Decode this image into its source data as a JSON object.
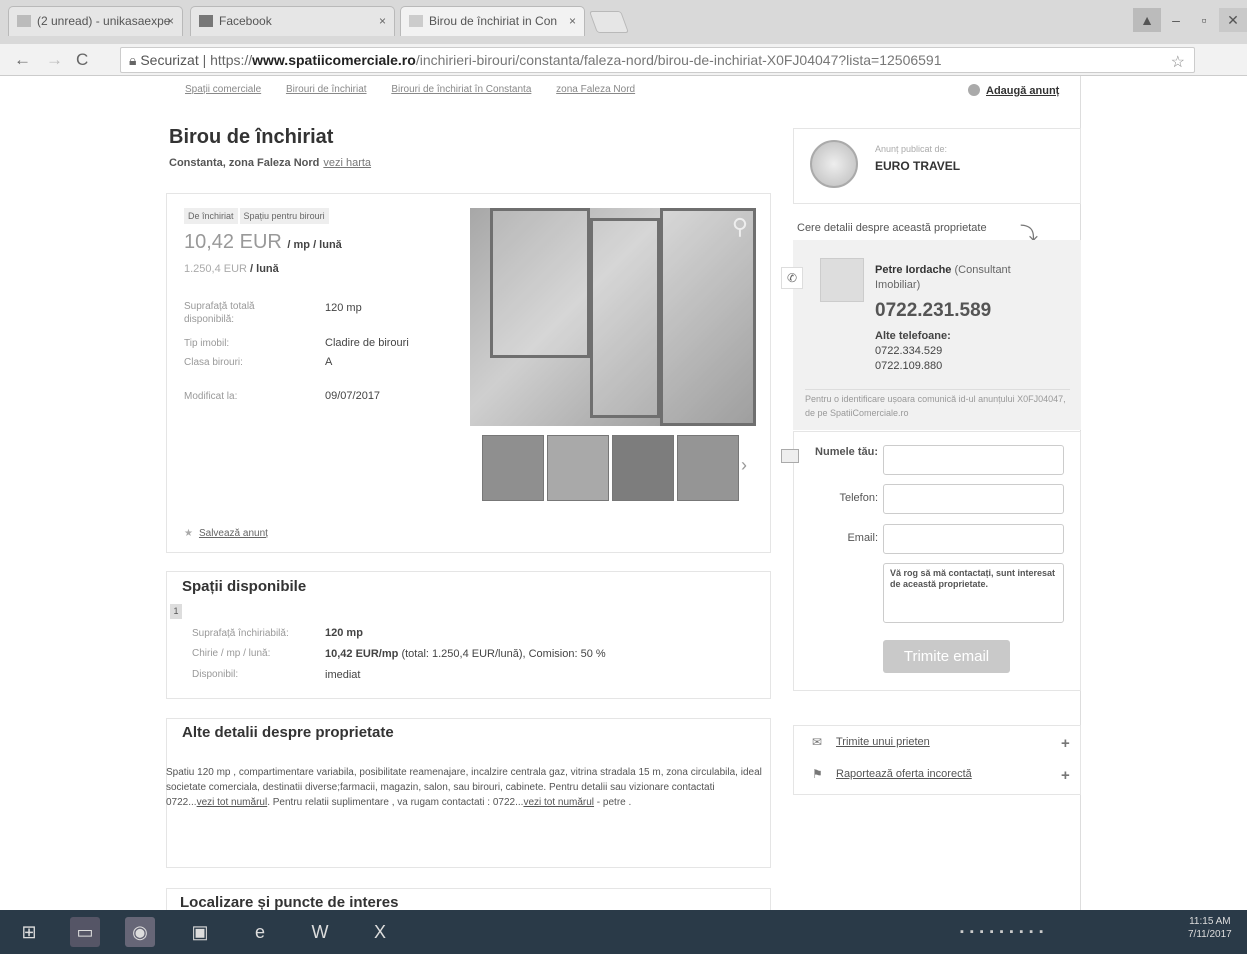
{
  "browser": {
    "tabs": [
      {
        "label": "(2 unread) - unikasaexpe"
      },
      {
        "label": "Facebook"
      },
      {
        "label": "Birou de închiriat in Con"
      }
    ],
    "url_secure": "Securizat",
    "url_prefix": "https://",
    "url_domain": "www.spatiicomerciale.ro",
    "url_path": "/inchirieri-birouri/constanta/faleza-nord/birou-de-inchiriat-X0FJ04047?lista=12506591"
  },
  "breadcrumb": [
    "Spații comerciale",
    "Birouri de închiriat",
    "Birouri de închiriat în Constanta",
    "zona Faleza Nord"
  ],
  "add_ad": "Adaugă anunț",
  "listing": {
    "title": "Birou de închiriat",
    "location": "Constanta, zona Faleza Nord",
    "map_link": "vezi harta",
    "tags": [
      "De închiriat",
      "Spațiu pentru birouri"
    ],
    "price": "10,42 EUR",
    "price_unit": "/ mp / lună",
    "price_total": "1.250,4 EUR",
    "price_total_unit": "/ lună",
    "specs": [
      {
        "label": "Suprafață totală disponibilă:",
        "value": "120 mp"
      },
      {
        "label": "Tip imobil:",
        "value": "Cladire de birouri"
      },
      {
        "label": "Clasa birouri:",
        "value": "A"
      },
      {
        "label": "Modificat la:",
        "value": "09/07/2017"
      }
    ],
    "save": "Salvează anunț"
  },
  "spaces": {
    "heading": "Spații disponibile",
    "index": "1",
    "rows": [
      {
        "label": "Suprafață închiriabilă:",
        "value": "120 mp"
      },
      {
        "label": "Chirie / mp / lună:",
        "value_bold": "10,42 EUR/mp",
        "value": "(total: 1.250,4 EUR/lună), Comision: 50 %"
      },
      {
        "label": "Disponibil:",
        "value": "imediat"
      }
    ]
  },
  "details": {
    "heading": "Alte detalii despre proprietate",
    "text1": "Spatiu 120 mp , compartimentare variabila, posibilitate reamenajare, incalzire centrala gaz, vitrina stradala 15 m, zona circulabila, ideal societate comerciala, destinatii diverse;farmacii, magazin, salon, sau birouri, cabinete. Pentru detalii sau vizionare contactati 0722...",
    "link1": "vezi tot numărul",
    "text2": ". Pentru relatii suplimentare , va rugam contactati : 0722...",
    "link2": "vezi tot numărul",
    "text3": " - petre ."
  },
  "location_heading": "Localizare și puncte de interes",
  "publisher": {
    "label": "Anunț publicat de:",
    "name": "EURO TRAVEL"
  },
  "contact": {
    "ask": "Cere detalii despre această proprietate",
    "agent_name": "Petre Iordache",
    "agent_role": "(Consultant Imobiliar)",
    "phone": "0722.231.589",
    "alt_label": "Alte telefoane:",
    "alt_phones": [
      "0722.334.529",
      "0722.109.880"
    ],
    "note": "Pentru o identificare ușoara comunică id-ul anunțului X0FJ04047, de pe SpatiiComerciale.ro"
  },
  "form": {
    "name_label": "Numele tău:",
    "phone_label": "Telefon:",
    "email_label": "Email:",
    "message": "Vă rog să mă contactați, sunt interesat de această proprietate.",
    "send": "Trimite email"
  },
  "actions": [
    "Trimite unui prieten",
    "Raportează oferta incorectă"
  ],
  "clock": {
    "time": "11:15 AM",
    "date": "7/11/2017"
  }
}
